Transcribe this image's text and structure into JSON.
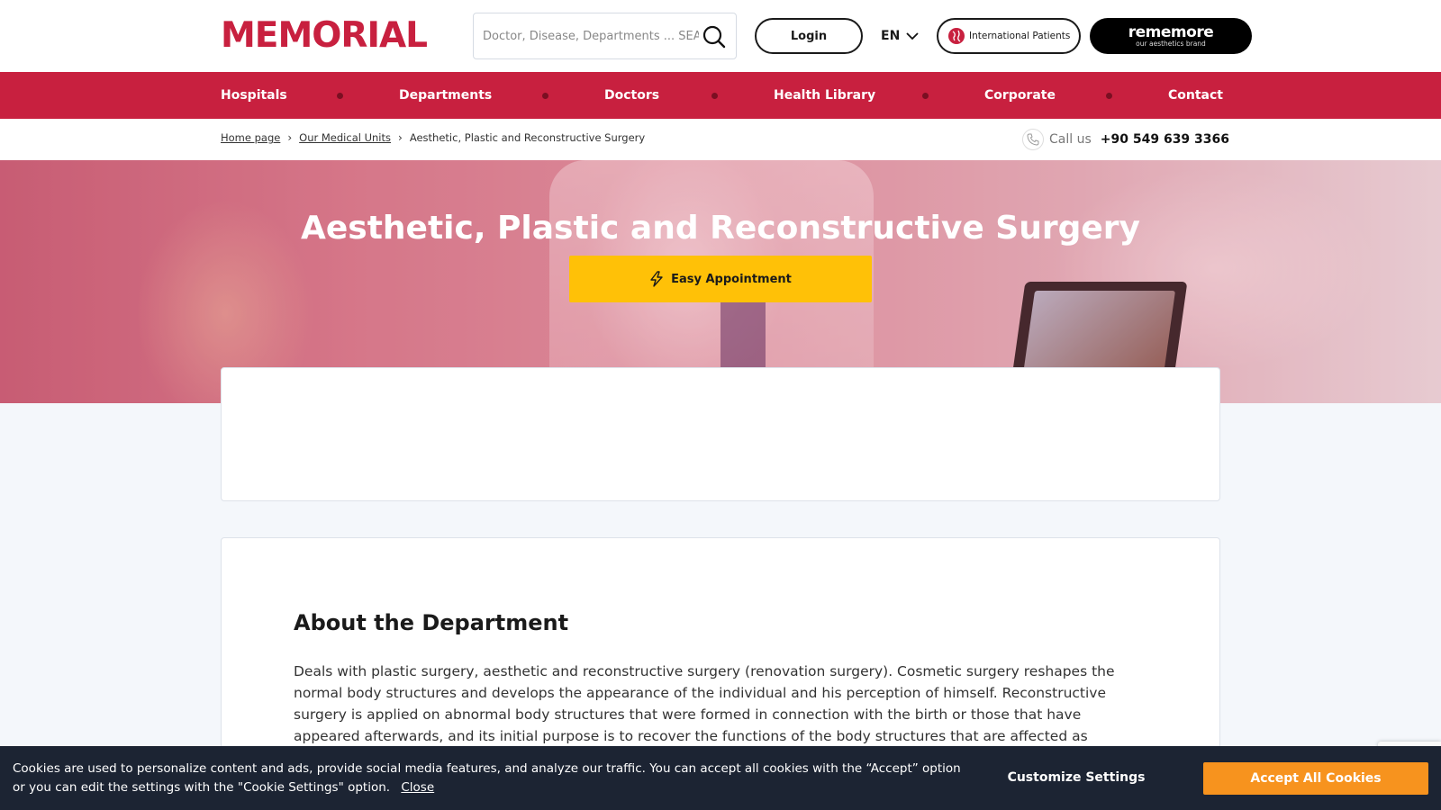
{
  "header": {
    "logo": "MEMORIAL",
    "search": {
      "placeholder": "Doctor, Disease, Departments ... SEARCH",
      "icon": "search-icon"
    },
    "login_label": "Login",
    "language": "EN",
    "international_label": "International Patients",
    "rememore": {
      "title": "rememore",
      "subtitle": "our aesthetics brand"
    }
  },
  "nav": {
    "items": [
      {
        "label": "Hospitals"
      },
      {
        "label": "Departments"
      },
      {
        "label": "Doctors"
      },
      {
        "label": "Health Library"
      },
      {
        "label": "Corporate"
      },
      {
        "label": "Contact"
      }
    ]
  },
  "breadcrumb": {
    "items": [
      {
        "label": "Home page"
      },
      {
        "label": "Our Medical Units"
      },
      {
        "label": "Aesthetic, Plastic and Reconstructive Surgery"
      }
    ]
  },
  "call": {
    "label": "Call us",
    "number": "+90 549 639 3366"
  },
  "hero": {
    "title": "Aesthetic, Plastic and Reconstructive Surgery",
    "appointment_label": "Easy Appointment"
  },
  "about": {
    "title": "About the Department",
    "text": "Deals with plastic surgery, aesthetic and reconstructive surgery (renovation surgery). Cosmetic surgery reshapes the normal body structures and develops the appearance of the individual and his perception of himself. Reconstructive surgery is applied on abnormal body structures that were formed in connection with the birth or those that have appeared afterwards, and its initial purpose is to recover the functions of the body structures that are affected as"
  },
  "cookie": {
    "text": "Cookies are used to personalize content and ads, provide social media features, and analyze our traffic. You can accept all cookies with the “Accept” option or you can edit the settings with the \"Cookie Settings\" option.",
    "close_label": "Close",
    "customize_label": "Customize Settings",
    "accept_label": "Accept All Cookies"
  },
  "colors": {
    "brand": "#c8203f",
    "appointment": "#ffc107",
    "accept": "#f7931e",
    "cookie_bg": "#1c2433"
  }
}
